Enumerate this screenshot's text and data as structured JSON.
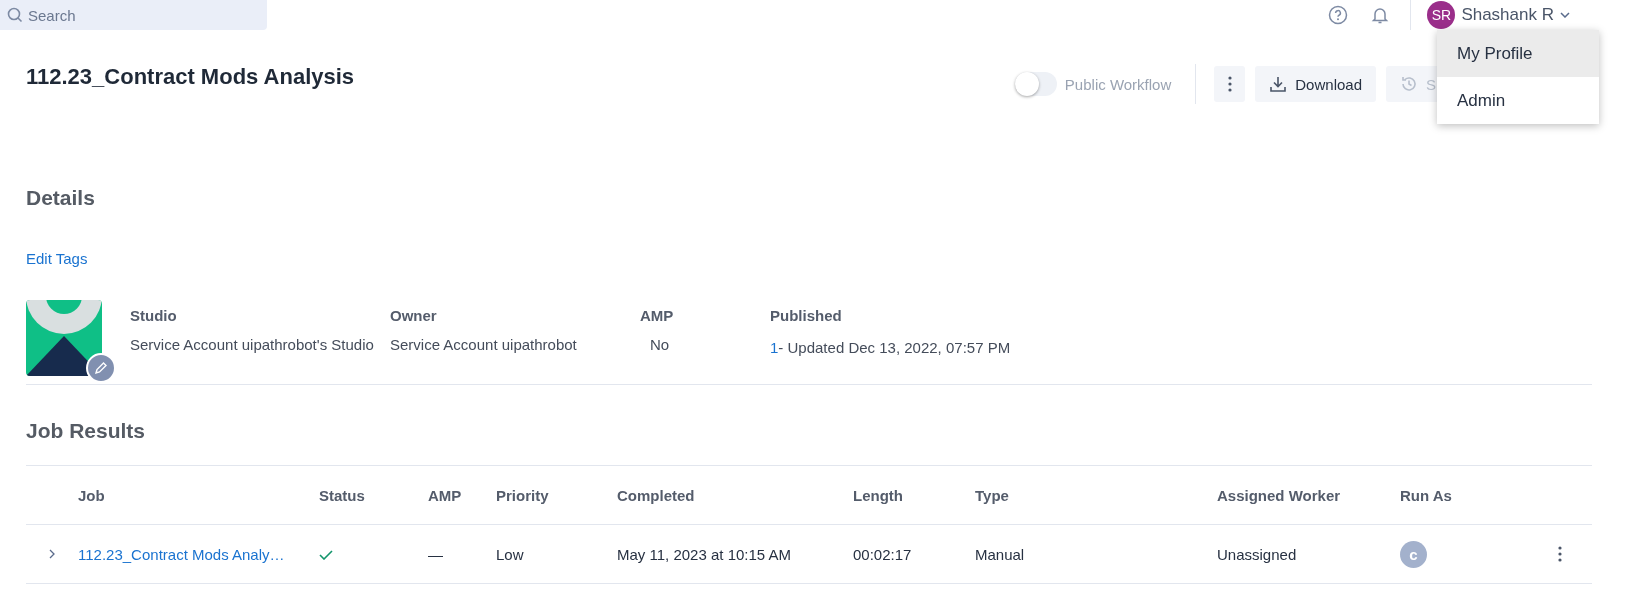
{
  "topbar": {
    "search": {
      "placeholder": "Search"
    },
    "user": {
      "initials": "SR",
      "name": "Shashank R"
    },
    "menu": [
      {
        "label": "My Profile",
        "selected": true
      },
      {
        "label": "Admin",
        "selected": false
      }
    ]
  },
  "page": {
    "title": "112.23_Contract Mods Analysis",
    "public_toggle": {
      "label": "Public Workflow",
      "on": false
    },
    "buttons": [
      {
        "kind": "more"
      },
      {
        "kind": "download",
        "label": "Download"
      },
      {
        "kind": "schedule",
        "label": "S"
      }
    ]
  },
  "details": {
    "heading": "Details",
    "edit_tags": "Edit Tags",
    "fields": [
      {
        "label": "Studio",
        "value": "Service Account uipathrobot's Studio"
      },
      {
        "label": "Owner",
        "value": "Service Account uipathrobot"
      },
      {
        "label": "AMP",
        "value": "No"
      }
    ],
    "published": {
      "label": "Published",
      "version": "1",
      "text": " - Updated Dec 13, 2022, 07:57 PM"
    }
  },
  "job_results": {
    "heading": "Job Results",
    "columns": [
      "Job",
      "Status",
      "AMP",
      "Priority",
      "Completed",
      "Length",
      "Type",
      "Assigned Worker",
      "Run As"
    ],
    "rows": [
      {
        "job": "112.23_Contract Mods Analy…",
        "succeeded": true,
        "amp": "—",
        "priority": "Low",
        "completed": "May 11, 2023 at 10:15 AM",
        "length": "00:02:17",
        "type": "Manual",
        "worker": "Unassigned",
        "run_as": "c",
        "expanded": false
      }
    ]
  }
}
